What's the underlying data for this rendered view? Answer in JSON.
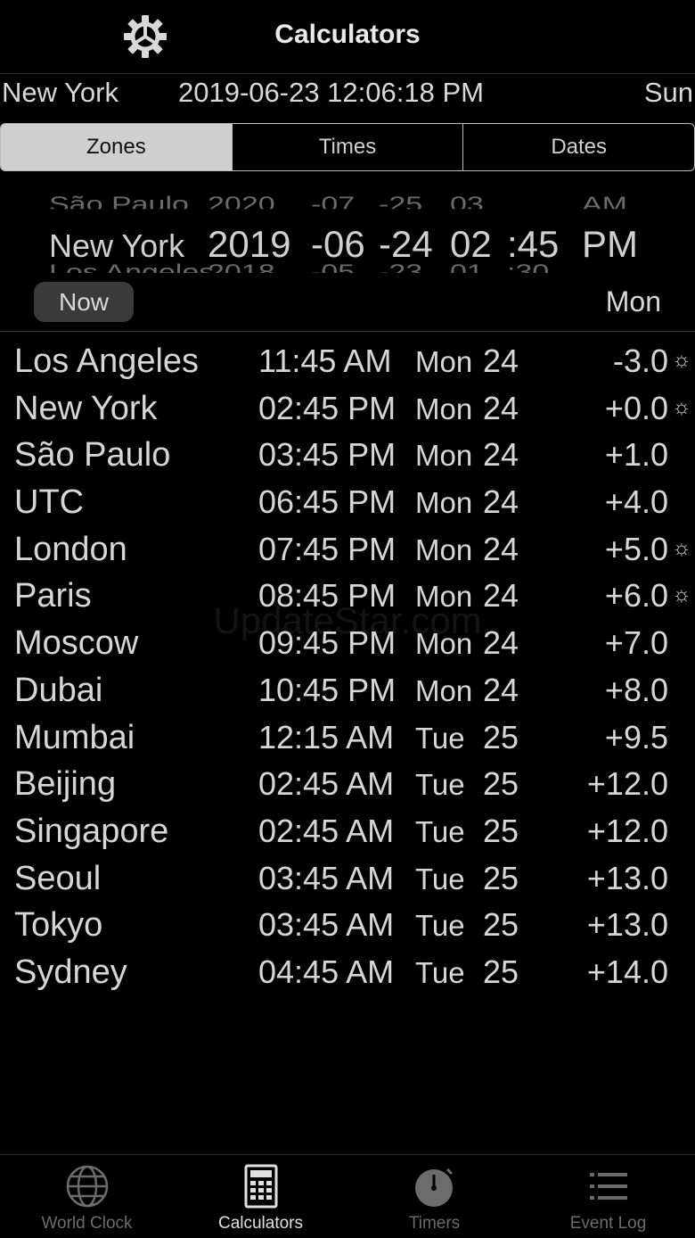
{
  "header": {
    "title": "Calculators",
    "settings_icon": "gear-icon"
  },
  "location": {
    "city": "New York",
    "datetime": "2019-06-23 12:06:18 PM",
    "day": "Sun"
  },
  "tabs": [
    {
      "label": "Zones",
      "active": true
    },
    {
      "label": "Times",
      "active": false
    },
    {
      "label": "Dates",
      "active": false
    }
  ],
  "picker": {
    "above": [
      "São Paulo",
      "2020",
      "-07",
      "-25",
      "03",
      "",
      "AM"
    ],
    "selected": {
      "city": "New York",
      "year": "2019",
      "month": "-06",
      "day": "-24",
      "hour": "02",
      "minute": ":45",
      "ampm": "PM"
    },
    "below": [
      "Los Angeles",
      "2018",
      "-05",
      "-23",
      "01",
      ":30",
      ""
    ],
    "now_label": "Now",
    "weekday": "Mon"
  },
  "zones": [
    {
      "city": "Los Angeles",
      "time": "11:45 AM",
      "day": "Mon",
      "date": "24",
      "offset": "-3.0",
      "dst": "☼"
    },
    {
      "city": "New York",
      "time": "02:45 PM",
      "day": "Mon",
      "date": "24",
      "offset": "+0.0",
      "dst": "☼"
    },
    {
      "city": "São Paulo",
      "time": "03:45 PM",
      "day": "Mon",
      "date": "24",
      "offset": "+1.0",
      "dst": ""
    },
    {
      "city": "UTC",
      "time": "06:45 PM",
      "day": "Mon",
      "date": "24",
      "offset": "+4.0",
      "dst": ""
    },
    {
      "city": "London",
      "time": "07:45 PM",
      "day": "Mon",
      "date": "24",
      "offset": "+5.0",
      "dst": "☼"
    },
    {
      "city": "Paris",
      "time": "08:45 PM",
      "day": "Mon",
      "date": "24",
      "offset": "+6.0",
      "dst": "☼"
    },
    {
      "city": "Moscow",
      "time": "09:45 PM",
      "day": "Mon",
      "date": "24",
      "offset": "+7.0",
      "dst": ""
    },
    {
      "city": "Dubai",
      "time": "10:45 PM",
      "day": "Mon",
      "date": "24",
      "offset": "+8.0",
      "dst": ""
    },
    {
      "city": "Mumbai",
      "time": "12:15 AM",
      "day": "Tue",
      "date": "25",
      "offset": "+9.5",
      "dst": ""
    },
    {
      "city": "Beijing",
      "time": "02:45 AM",
      "day": "Tue",
      "date": "25",
      "offset": "+12.0",
      "dst": ""
    },
    {
      "city": "Singapore",
      "time": "02:45 AM",
      "day": "Tue",
      "date": "25",
      "offset": "+12.0",
      "dst": ""
    },
    {
      "city": "Seoul",
      "time": "03:45 AM",
      "day": "Tue",
      "date": "25",
      "offset": "+13.0",
      "dst": ""
    },
    {
      "city": "Tokyo",
      "time": "03:45 AM",
      "day": "Tue",
      "date": "25",
      "offset": "+13.0",
      "dst": ""
    },
    {
      "city": "Sydney",
      "time": "04:45 AM",
      "day": "Tue",
      "date": "25",
      "offset": "+14.0",
      "dst": ""
    }
  ],
  "watermark": "UpdateStar.com",
  "tabbar": [
    {
      "label": "World Clock",
      "icon": "globe-icon",
      "active": false
    },
    {
      "label": "Calculators",
      "icon": "calculator-icon",
      "active": true
    },
    {
      "label": "Timers",
      "icon": "stopwatch-icon",
      "active": false
    },
    {
      "label": "Event Log",
      "icon": "list-icon",
      "active": false
    }
  ]
}
